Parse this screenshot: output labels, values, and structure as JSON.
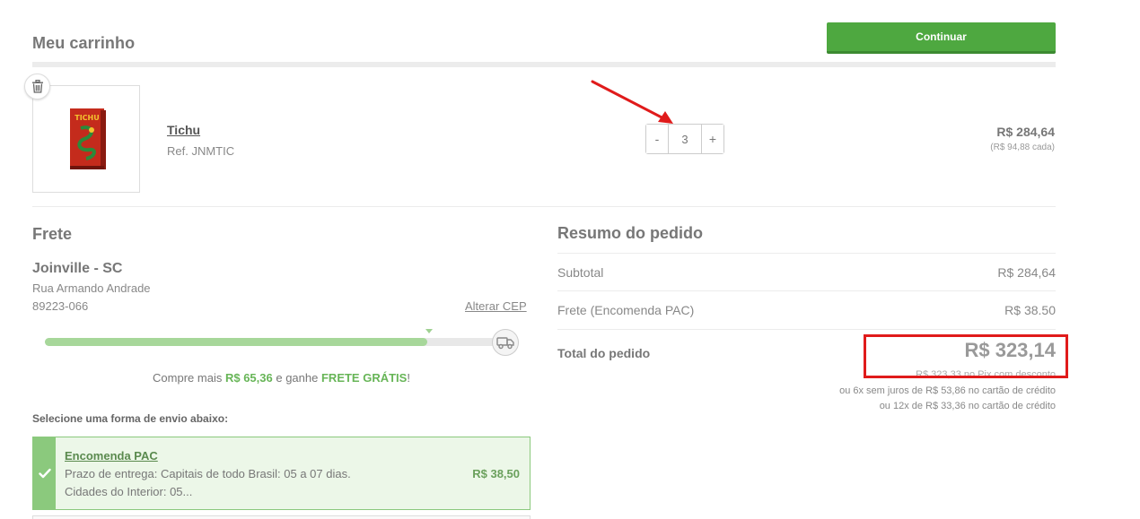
{
  "header": {
    "title": "Meu carrinho",
    "continue_label": "Continuar"
  },
  "cart_item": {
    "name": "Tichu",
    "ref": "Ref. JNMTIC",
    "quantity": "3",
    "minus_label": "-",
    "plus_label": "+",
    "total_price": "R$ 284,64",
    "unit_price": "(R$ 94,88 cada)",
    "thumbnail_text": "TICHU"
  },
  "freight": {
    "title": "Frete",
    "city": "Joinville - SC",
    "street": "Rua Armando Andrade",
    "cep": "89223-066",
    "change_cep_label": "Alterar CEP",
    "progress_fraction": 0.82,
    "free_msg_prefix": "Compre mais",
    "free_msg_amount": "R$ 65,36",
    "free_msg_middle": "e ganhe",
    "free_msg_highlight": "FRETE GRÁTIS",
    "free_msg_suffix": "!",
    "select_label": "Selecione uma forma de envio abaixo:",
    "option": {
      "name": "Encomenda PAC",
      "line1": "Prazo de entrega: Capitais de todo Brasil: 05 a 07 dias.",
      "line2": "Cidades do Interior: 05...",
      "price": "R$ 38,50"
    }
  },
  "summary": {
    "title": "Resumo do pedido",
    "subtotal_label": "Subtotal",
    "subtotal_value": "R$ 284,64",
    "shipping_label": "Frete (Encomenda PAC)",
    "shipping_value": "R$ 38.50",
    "total_label": "Total do pedido",
    "total_value": "R$ 323,14",
    "pix_line": "R$ 323,33 no Pix com desconto",
    "installment_6": "ou 6x sem juros de R$ 53,86 no cartão de crédito",
    "installment_12": "ou 12x de R$ 33,36 no cartão de crédito"
  },
  "colors": {
    "accent_green": "#4ea840",
    "highlight_red": "#e01b1b",
    "annotation_arrow": "#e01b1b"
  }
}
